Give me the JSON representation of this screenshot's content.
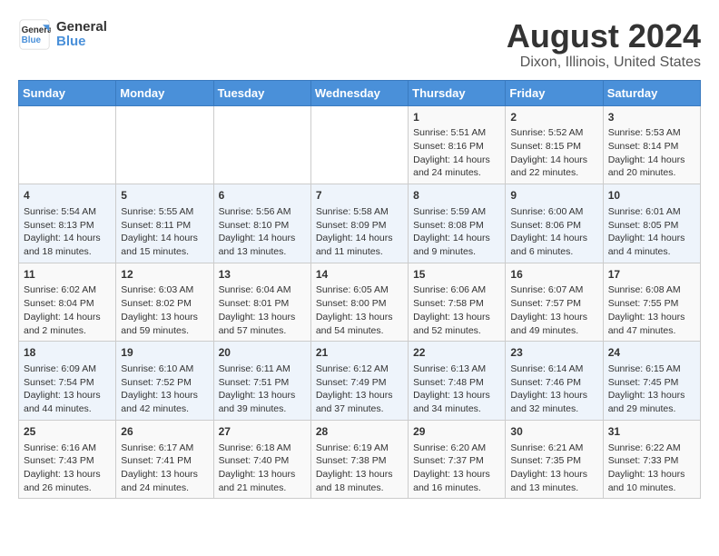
{
  "logo": {
    "line1": "General",
    "line2": "Blue"
  },
  "title": "August 2024",
  "subtitle": "Dixon, Illinois, United States",
  "days_of_week": [
    "Sunday",
    "Monday",
    "Tuesday",
    "Wednesday",
    "Thursday",
    "Friday",
    "Saturday"
  ],
  "weeks": [
    [
      {
        "day": "",
        "info": ""
      },
      {
        "day": "",
        "info": ""
      },
      {
        "day": "",
        "info": ""
      },
      {
        "day": "",
        "info": ""
      },
      {
        "day": "1",
        "info": "Sunrise: 5:51 AM\nSunset: 8:16 PM\nDaylight: 14 hours\nand 24 minutes."
      },
      {
        "day": "2",
        "info": "Sunrise: 5:52 AM\nSunset: 8:15 PM\nDaylight: 14 hours\nand 22 minutes."
      },
      {
        "day": "3",
        "info": "Sunrise: 5:53 AM\nSunset: 8:14 PM\nDaylight: 14 hours\nand 20 minutes."
      }
    ],
    [
      {
        "day": "4",
        "info": "Sunrise: 5:54 AM\nSunset: 8:13 PM\nDaylight: 14 hours\nand 18 minutes."
      },
      {
        "day": "5",
        "info": "Sunrise: 5:55 AM\nSunset: 8:11 PM\nDaylight: 14 hours\nand 15 minutes."
      },
      {
        "day": "6",
        "info": "Sunrise: 5:56 AM\nSunset: 8:10 PM\nDaylight: 14 hours\nand 13 minutes."
      },
      {
        "day": "7",
        "info": "Sunrise: 5:58 AM\nSunset: 8:09 PM\nDaylight: 14 hours\nand 11 minutes."
      },
      {
        "day": "8",
        "info": "Sunrise: 5:59 AM\nSunset: 8:08 PM\nDaylight: 14 hours\nand 9 minutes."
      },
      {
        "day": "9",
        "info": "Sunrise: 6:00 AM\nSunset: 8:06 PM\nDaylight: 14 hours\nand 6 minutes."
      },
      {
        "day": "10",
        "info": "Sunrise: 6:01 AM\nSunset: 8:05 PM\nDaylight: 14 hours\nand 4 minutes."
      }
    ],
    [
      {
        "day": "11",
        "info": "Sunrise: 6:02 AM\nSunset: 8:04 PM\nDaylight: 14 hours\nand 2 minutes."
      },
      {
        "day": "12",
        "info": "Sunrise: 6:03 AM\nSunset: 8:02 PM\nDaylight: 13 hours\nand 59 minutes."
      },
      {
        "day": "13",
        "info": "Sunrise: 6:04 AM\nSunset: 8:01 PM\nDaylight: 13 hours\nand 57 minutes."
      },
      {
        "day": "14",
        "info": "Sunrise: 6:05 AM\nSunset: 8:00 PM\nDaylight: 13 hours\nand 54 minutes."
      },
      {
        "day": "15",
        "info": "Sunrise: 6:06 AM\nSunset: 7:58 PM\nDaylight: 13 hours\nand 52 minutes."
      },
      {
        "day": "16",
        "info": "Sunrise: 6:07 AM\nSunset: 7:57 PM\nDaylight: 13 hours\nand 49 minutes."
      },
      {
        "day": "17",
        "info": "Sunrise: 6:08 AM\nSunset: 7:55 PM\nDaylight: 13 hours\nand 47 minutes."
      }
    ],
    [
      {
        "day": "18",
        "info": "Sunrise: 6:09 AM\nSunset: 7:54 PM\nDaylight: 13 hours\nand 44 minutes."
      },
      {
        "day": "19",
        "info": "Sunrise: 6:10 AM\nSunset: 7:52 PM\nDaylight: 13 hours\nand 42 minutes."
      },
      {
        "day": "20",
        "info": "Sunrise: 6:11 AM\nSunset: 7:51 PM\nDaylight: 13 hours\nand 39 minutes."
      },
      {
        "day": "21",
        "info": "Sunrise: 6:12 AM\nSunset: 7:49 PM\nDaylight: 13 hours\nand 37 minutes."
      },
      {
        "day": "22",
        "info": "Sunrise: 6:13 AM\nSunset: 7:48 PM\nDaylight: 13 hours\nand 34 minutes."
      },
      {
        "day": "23",
        "info": "Sunrise: 6:14 AM\nSunset: 7:46 PM\nDaylight: 13 hours\nand 32 minutes."
      },
      {
        "day": "24",
        "info": "Sunrise: 6:15 AM\nSunset: 7:45 PM\nDaylight: 13 hours\nand 29 minutes."
      }
    ],
    [
      {
        "day": "25",
        "info": "Sunrise: 6:16 AM\nSunset: 7:43 PM\nDaylight: 13 hours\nand 26 minutes."
      },
      {
        "day": "26",
        "info": "Sunrise: 6:17 AM\nSunset: 7:41 PM\nDaylight: 13 hours\nand 24 minutes."
      },
      {
        "day": "27",
        "info": "Sunrise: 6:18 AM\nSunset: 7:40 PM\nDaylight: 13 hours\nand 21 minutes."
      },
      {
        "day": "28",
        "info": "Sunrise: 6:19 AM\nSunset: 7:38 PM\nDaylight: 13 hours\nand 18 minutes."
      },
      {
        "day": "29",
        "info": "Sunrise: 6:20 AM\nSunset: 7:37 PM\nDaylight: 13 hours\nand 16 minutes."
      },
      {
        "day": "30",
        "info": "Sunrise: 6:21 AM\nSunset: 7:35 PM\nDaylight: 13 hours\nand 13 minutes."
      },
      {
        "day": "31",
        "info": "Sunrise: 6:22 AM\nSunset: 7:33 PM\nDaylight: 13 hours\nand 10 minutes."
      }
    ]
  ]
}
